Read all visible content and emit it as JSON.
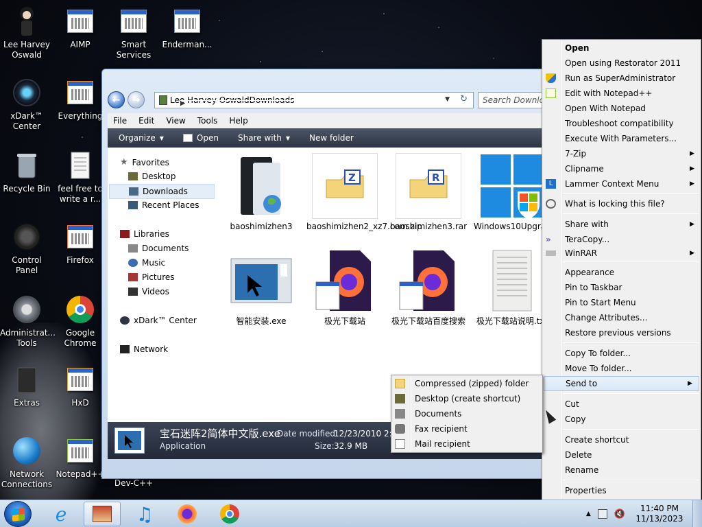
{
  "desktop": {
    "icons": [
      {
        "label": "Lee Harvey Oswald"
      },
      {
        "label": "AIMP"
      },
      {
        "label": "Smart Services"
      },
      {
        "label": "Enderman..."
      },
      {
        "label": "xDark™ Center"
      },
      {
        "label": "Everything"
      },
      {
        "label": "Recycle Bin"
      },
      {
        "label": "feel free to write a r..."
      },
      {
        "label": "Control Panel"
      },
      {
        "label": "Firefox"
      },
      {
        "label": "Administrat... Tools"
      },
      {
        "label": "Google Chrome"
      },
      {
        "label": "Extras"
      },
      {
        "label": "HxD"
      },
      {
        "label": "Network Connections"
      },
      {
        "label": "Notepad++"
      },
      {
        "label": "Dev-C++"
      }
    ]
  },
  "explorer": {
    "breadcrumb": [
      "Lee Harvey Oswald",
      "Downloads"
    ],
    "search_placeholder": "Search Downloads",
    "menu": [
      "File",
      "Edit",
      "View",
      "Tools",
      "Help"
    ],
    "toolbar": {
      "organize": "Organize",
      "open": "Open",
      "share": "Share with",
      "new_folder": "New folder"
    },
    "nav": {
      "favorites": "Favorites",
      "desktop": "Desktop",
      "downloads": "Downloads",
      "recent": "Recent Places",
      "libraries": "Libraries",
      "documents": "Documents",
      "music": "Music",
      "pictures": "Pictures",
      "videos": "Videos",
      "xdark": "xDark™ Center",
      "network": "Network"
    },
    "files": [
      {
        "name": "baoshimizhen3"
      },
      {
        "name": "baoshimizhen2_xz7.com.zip"
      },
      {
        "name": "baoshimizhen3.rar"
      },
      {
        "name": "Windows10Upgrade9252.exe"
      },
      {
        "name": "智能安装.exe"
      },
      {
        "name": "极光下载站"
      },
      {
        "name": "极光下载站百度搜索"
      },
      {
        "name": "极光下载站说明.txt"
      }
    ],
    "details": {
      "filename": "宝石迷阵2简体中文版.exe",
      "type": "Application",
      "modified_label": "Date modified:",
      "modified_value": "12/23/2010 2:39",
      "size_label": "Size:",
      "size_value": "32.9 MB"
    }
  },
  "context_menu": {
    "items": [
      "Open",
      "Open using Restorator 2011",
      "Run as SuperAdministrator",
      "Edit with Notepad++",
      "Open With Notepad",
      "Troubleshoot compatibility",
      "Execute With Parameters...",
      "7-Zip",
      "Clipname",
      "Lammer Context Menu",
      "What is locking this file?",
      "Share with",
      "TeraCopy...",
      "WinRAR",
      "Appearance",
      "Pin to Taskbar",
      "Pin to Start Menu",
      "Change Attributes...",
      "Restore previous versions",
      "Copy To folder...",
      "Move To folder...",
      "Send to",
      "Cut",
      "Copy",
      "Create shortcut",
      "Delete",
      "Rename",
      "Properties"
    ]
  },
  "send_to_menu": {
    "items": [
      "Compressed (zipped) folder",
      "Desktop (create shortcut)",
      "Documents",
      "Fax recipient",
      "Mail recipient"
    ]
  },
  "taskbar": {
    "time": "11:40 PM",
    "date": "11/13/2023"
  }
}
